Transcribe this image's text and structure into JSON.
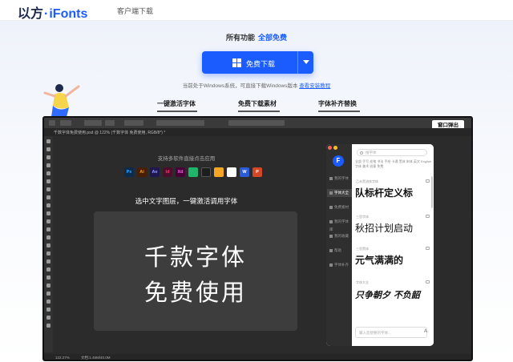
{
  "header": {
    "logo_cn": "以方",
    "logo_dot": "·",
    "logo_brand": "iFonts",
    "nav_link": "客户端下载"
  },
  "hero": {
    "free_prefix": "所有功能",
    "free_highlight": "全部免费",
    "download_label": "免费下载",
    "sys_note_text": "当前处于Windows系统，可直接下载Windows版本",
    "sys_note_link": "查看安装教程"
  },
  "tabs": [
    {
      "label": "一键激活字体",
      "active": true
    },
    {
      "label": "免费下载素材",
      "active": false
    },
    {
      "label": "字体补齐替换",
      "active": false
    }
  ],
  "ps": {
    "doc_tab": "千数字体免费使用.psd @ 122% (千数字体 免费使用, RGB/8*) *",
    "popup_button": "窗口弹出",
    "support_text": "支持多软件直接点击应用",
    "app_icons": [
      {
        "label": "Ps",
        "color": "#0d2b4d"
      },
      {
        "label": "Ai",
        "color": "#4a1e02"
      },
      {
        "label": "Ae",
        "color": "#1f1850"
      },
      {
        "label": "Id",
        "color": "#4b0f2b"
      },
      {
        "label": "Xd",
        "color": "#470137"
      },
      {
        "label": "",
        "color": "#1fb56a"
      },
      {
        "label": "",
        "color": "#1e1e1e"
      },
      {
        "label": "",
        "color": "#f5a623"
      },
      {
        "label": "",
        "color": "#ffffff"
      },
      {
        "label": "W",
        "color": "#2b5bd7"
      },
      {
        "label": "P",
        "color": "#d24726"
      }
    ],
    "select_hint": "选中文字图层，一键激活调用字体",
    "canvas_line1": "千款字体",
    "canvas_line2": "免费使用",
    "status_zoom": "122.27%",
    "status_doc": "文档:1.46M/40.0M"
  },
  "panel": {
    "search_placeholder": "搜字体",
    "categories": "全部 手写 毛笔 书法 手绘 卡通 黑体 宋体 英文 English 字体 美术 创意 免费",
    "side_items": [
      "我的字体",
      "字体大全",
      "免费素材",
      "我的字体库",
      "我的收藏",
      "帮助",
      "字体补齐"
    ],
    "fonts": [
      {
        "label": "乙未黑流体字体",
        "sample": "队标杆定义标"
      },
      {
        "label": "三思字体",
        "sample": "秋招计划启动"
      },
      {
        "label": "三思黑体",
        "sample": "元气满满的"
      },
      {
        "label": "字体大全",
        "sample": "只争朝夕 不负韶"
      }
    ],
    "input_placeholder": "输入您想要的字体...",
    "font_btn": "A"
  },
  "colors": {
    "accent": "#1a5cff",
    "ps_bg": "#2b2b2b",
    "panel_side": "#2f2f2f"
  }
}
